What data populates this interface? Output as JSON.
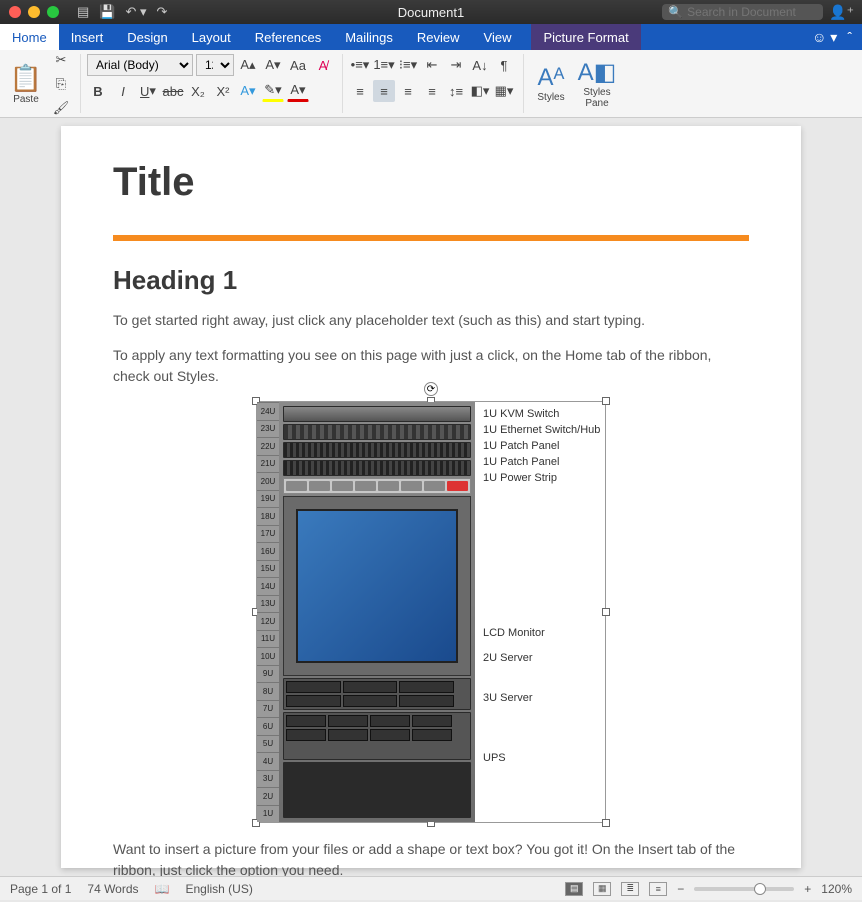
{
  "window": {
    "title": "Document1",
    "search_placeholder": "Search in Document"
  },
  "tabs": {
    "items": [
      "Home",
      "Insert",
      "Design",
      "Layout",
      "References",
      "Mailings",
      "Review",
      "View"
    ],
    "context": "Picture Format",
    "active": "Home"
  },
  "ribbon": {
    "paste": "Paste",
    "font_name": "Arial (Body)",
    "font_size": "12",
    "styles": "Styles",
    "styles_pane": "Styles Pane"
  },
  "document": {
    "title": "Title",
    "h1": "Heading 1",
    "p1": "To get started right away, just click any placeholder text (such as this) and start typing.",
    "p2": "To apply any text formatting you see on this page with just a click, on the Home tab of the ribbon, check out Styles.",
    "p3": "Want to insert a picture from your files or add a shape or text box? You got it! On the Insert tab of the ribbon, just click the option you need."
  },
  "rack": {
    "ruler": [
      "1U",
      "2U",
      "3U",
      "4U",
      "5U",
      "6U",
      "7U",
      "8U",
      "9U",
      "10U",
      "11U",
      "12U",
      "13U",
      "14U",
      "15U",
      "16U",
      "17U",
      "18U",
      "19U",
      "20U",
      "21U",
      "22U",
      "23U",
      "24U"
    ],
    "labels": {
      "kvm": "1U KVM Switch",
      "eth": "1U Ethernet Switch/Hub",
      "patch1": "1U Patch Panel",
      "patch2": "1U Patch Panel",
      "power": "1U Power Strip",
      "lcd": "LCD Monitor",
      "srv2": "2U Server",
      "srv3": "3U Server",
      "ups": "UPS"
    }
  },
  "status": {
    "page": "Page 1 of 1",
    "words": "74 Words",
    "lang": "English (US)",
    "zoom": "120%"
  }
}
